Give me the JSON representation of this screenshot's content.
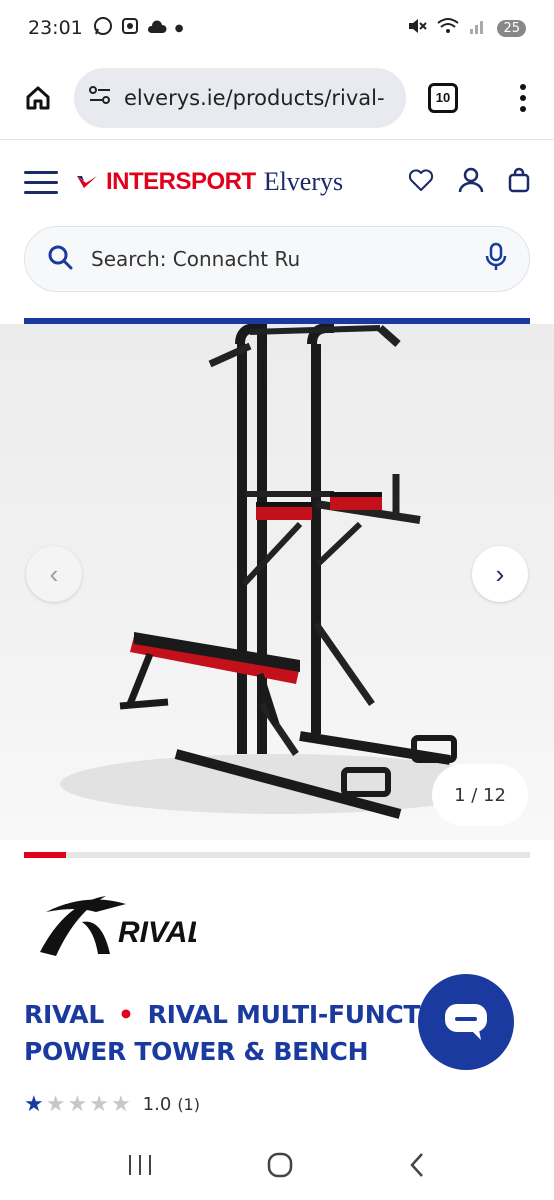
{
  "status_bar": {
    "time": "23:01",
    "battery": "25"
  },
  "browser": {
    "url": "elverys.ie/products/rival-",
    "tab_count": "10"
  },
  "site": {
    "logo_intersport": "INTERSPORT",
    "logo_elverys": "Elverys"
  },
  "search": {
    "placeholder": "Search: Connacht Ru"
  },
  "gallery": {
    "counter": "1 / 12",
    "progress": 0.083
  },
  "product": {
    "brand": "RIVAL",
    "title_line1": "RIVAL MULTI-FUNCTI",
    "title_line2": "POWER TOWER & BENCH",
    "rating_score": "1.0",
    "rating_count": "(1)",
    "stars_filled": 1,
    "stars_total": 5,
    "brand_logo_text": "RIVAL"
  },
  "colors": {
    "brand_blue": "#1b3aa0",
    "brand_red": "#e2001a",
    "navy": "#1b2a6b"
  }
}
